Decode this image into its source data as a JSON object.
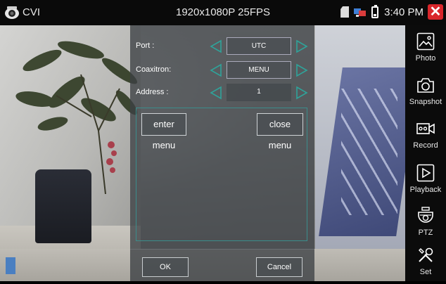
{
  "status_bar": {
    "app_label": "CVI",
    "resolution": "1920x1080P 25FPS",
    "time": "3:40 PM",
    "close_label": "✕"
  },
  "dialog": {
    "port": {
      "label": "Port :",
      "value": "UTC"
    },
    "coaxitron": {
      "label": "Coaxitron:",
      "value": "MENU"
    },
    "address": {
      "label": "Address :",
      "value": "1"
    },
    "enter_menu_label": "enter menu",
    "close_menu_label": "close menu",
    "ok_label": "OK",
    "cancel_label": "Cancel"
  },
  "sidebar": {
    "items": [
      {
        "label": "Photo",
        "icon": "photo-icon"
      },
      {
        "label": "Snapshot",
        "icon": "camera-icon"
      },
      {
        "label": "Record",
        "icon": "record-icon"
      },
      {
        "label": "Playback",
        "icon": "play-icon"
      },
      {
        "label": "PTZ",
        "icon": "ptz-camera-icon"
      },
      {
        "label": "Set",
        "icon": "settings-tools-icon"
      }
    ]
  },
  "colors": {
    "accent_arrow": "#2fa39a",
    "close_red": "#d9262b",
    "panel_border": "#3b8d8c"
  }
}
